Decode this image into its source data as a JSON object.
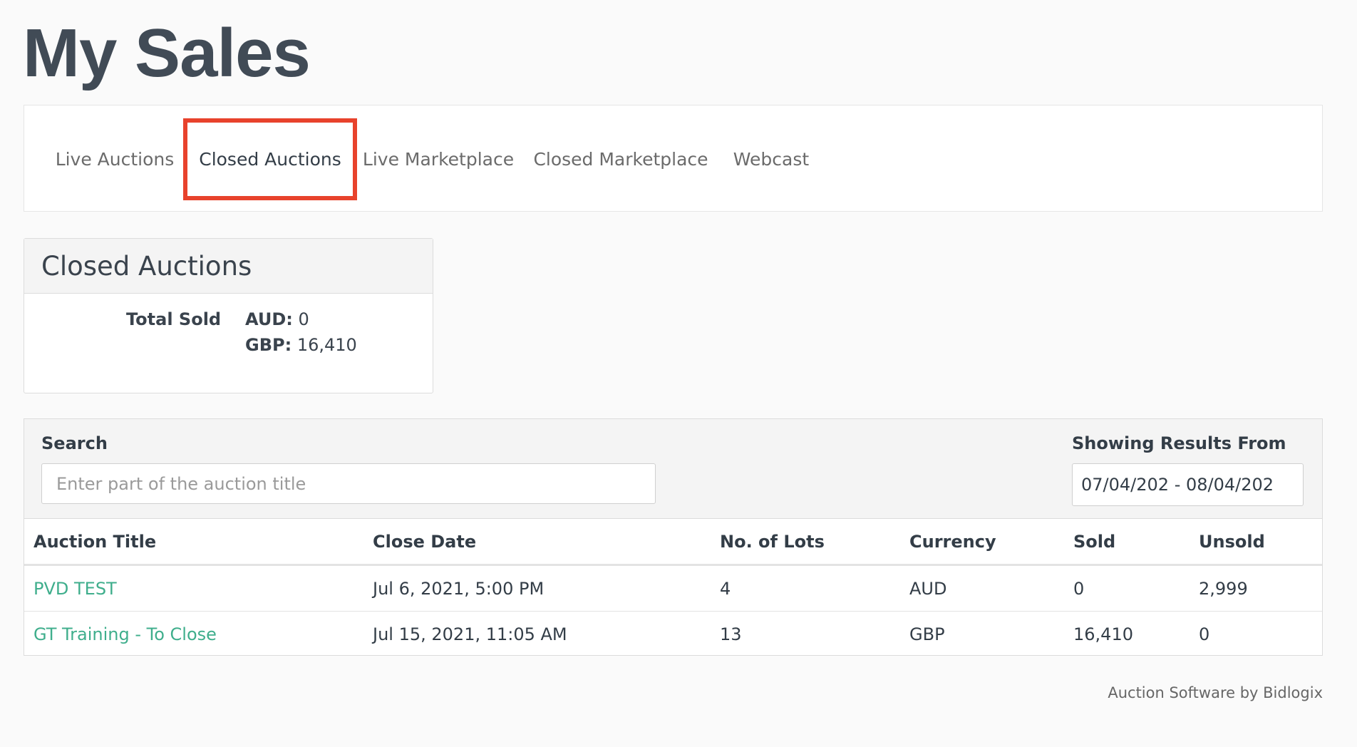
{
  "page": {
    "title": "My Sales"
  },
  "tabs": [
    {
      "label": "Live Auctions"
    },
    {
      "label": "Closed Auctions"
    },
    {
      "label": "Live Marketplace"
    },
    {
      "label": "Closed Marketplace"
    },
    {
      "label": "Webcast"
    }
  ],
  "summary": {
    "title": "Closed Auctions",
    "total_sold_label": "Total Sold",
    "currencies": [
      {
        "code": "AUD:",
        "value": "0"
      },
      {
        "code": "GBP:",
        "value": "16,410"
      }
    ]
  },
  "filters": {
    "search_label": "Search",
    "search_placeholder": "Enter part of the auction title",
    "date_label": "Showing Results From",
    "date_range": "07/04/202  -  08/04/202"
  },
  "table": {
    "headers": [
      "Auction Title",
      "Close Date",
      "No. of Lots",
      "Currency",
      "Sold",
      "Unsold"
    ],
    "rows": [
      [
        "PVD TEST",
        "Jul 6, 2021, 5:00 PM",
        "4",
        "AUD",
        "0",
        "2,999"
      ],
      [
        "GT Training - To Close",
        "Jul 15, 2021, 11:05 AM",
        "13",
        "GBP",
        "16,410",
        "0"
      ]
    ]
  },
  "footer": {
    "text": "Auction Software by Bidlogix"
  },
  "colors": {
    "link": "#3fae8c",
    "highlight": "#e8422c",
    "heading": "#414b56"
  }
}
